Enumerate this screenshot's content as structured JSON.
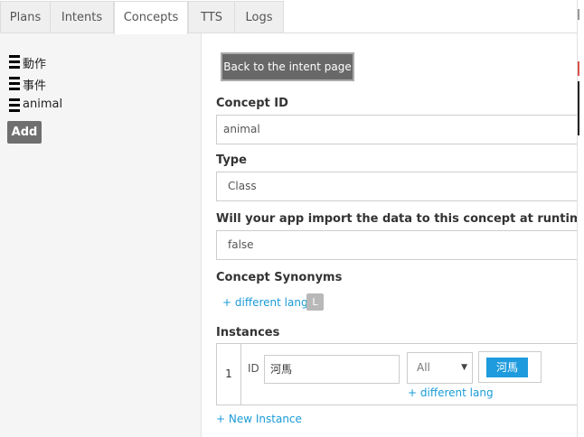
{
  "tabs": [
    {
      "label": "Plans"
    },
    {
      "label": "Intents"
    },
    {
      "label": "Concepts"
    },
    {
      "label": "TTS"
    },
    {
      "label": "Logs"
    }
  ],
  "sidebar": {
    "items": [
      {
        "label": "動作"
      },
      {
        "label": "事件"
      },
      {
        "label": "animal"
      }
    ],
    "add_label": "Add"
  },
  "main": {
    "back_label": "Back to the intent page",
    "concept_id": {
      "label": "Concept ID",
      "value": "animal"
    },
    "type": {
      "label": "Type",
      "value": "Class"
    },
    "runtime": {
      "label": "Will your app import the data to this concept at runtime ?",
      "value": "false"
    },
    "synonyms": {
      "label": "Concept Synonyms",
      "link": "+ different lang",
      "badge": "L"
    },
    "instances": {
      "label": "Instances",
      "rows": [
        {
          "num": "1",
          "id_label": "ID",
          "id_value": "河馬",
          "lang": "All",
          "synonym": "河馬",
          "link": "+ different lang"
        }
      ],
      "new_link": "+ New Instance"
    }
  }
}
